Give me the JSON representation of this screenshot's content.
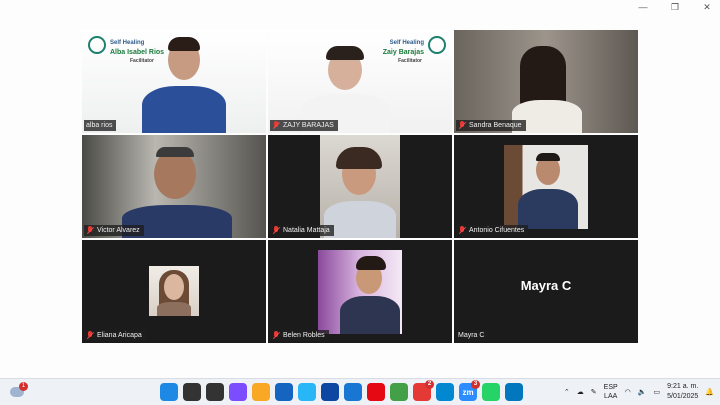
{
  "participants": [
    {
      "name": "alba rios",
      "active": true,
      "logo_title": "Self Healing",
      "logo_name": "Alba Isabel Rios",
      "logo_role": "Facilitator"
    },
    {
      "name": "ZAJY BARAJAS",
      "active": false,
      "logo_title": "Self Healing",
      "logo_name": "Zaiy Barajas",
      "logo_role": "Facilitator"
    },
    {
      "name": "Sandra Benaque"
    },
    {
      "name": "Victor Alvarez"
    },
    {
      "name": "Natalia Mattaja"
    },
    {
      "name": "Antonio Cifuentes"
    },
    {
      "name": "Eliana Aricapa"
    },
    {
      "name": "Belen Robles"
    },
    {
      "name": "Mayra C",
      "initials": "Mayra C"
    }
  ],
  "taskbar": {
    "notification_count": "1",
    "apps": [
      {
        "icon": "windows-start-icon",
        "color": "#1e88e5"
      },
      {
        "icon": "search-icon",
        "color": "#333333"
      },
      {
        "icon": "task-view-icon",
        "color": "#333333"
      },
      {
        "icon": "copilot-icon",
        "color": "#7c4dff"
      },
      {
        "icon": "file-explorer-icon",
        "color": "#f9a825"
      },
      {
        "icon": "store-icon",
        "color": "#1565c0"
      },
      {
        "icon": "teams-icon",
        "color": "#29b6f6"
      },
      {
        "icon": "edge-icon",
        "color": "#0d47a1"
      },
      {
        "icon": "word-icon",
        "color": "#1976d2"
      },
      {
        "icon": "netflix-icon",
        "color": "#e50914"
      },
      {
        "icon": "chrome-icon",
        "color": "#43a047"
      },
      {
        "icon": "telegram-icon",
        "color": "#e53935",
        "badge": "2"
      },
      {
        "icon": "edge-alt-icon",
        "color": "#0288d1"
      },
      {
        "icon": "zoom-icon",
        "color": "#2d8cff",
        "label": "zm",
        "badge": "3"
      },
      {
        "icon": "whatsapp-icon",
        "color": "#25d366"
      },
      {
        "icon": "photos-icon",
        "color": "#0277bd"
      }
    ],
    "lang_top": "ESP",
    "lang_bottom": "LAA",
    "time": "9:21 a. m.",
    "date": "5/01/2025"
  }
}
